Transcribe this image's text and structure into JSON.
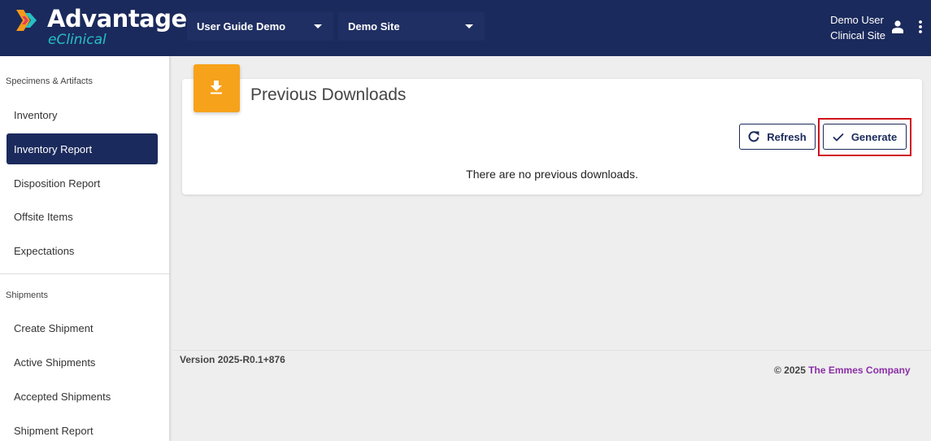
{
  "header": {
    "logo_title": "Advantage",
    "logo_subtitle": "eClinical",
    "study_dropdown": "User Guide Demo",
    "site_dropdown": "Demo Site",
    "user_name": "Demo User",
    "user_role": "Clinical Site",
    "icons": [
      "user-icon",
      "more-vertical-icon",
      "chevron-down-icon"
    ]
  },
  "sidebar": {
    "section1_label": "Specimens & Artifacts",
    "section1_items": [
      {
        "label": "Inventory"
      },
      {
        "label": "Inventory Report",
        "active": true
      },
      {
        "label": "Disposition Report"
      },
      {
        "label": "Offsite Items"
      },
      {
        "label": "Expectations"
      }
    ],
    "section2_label": "Shipments",
    "section2_items": [
      {
        "label": "Create Shipment"
      },
      {
        "label": "Active Shipments"
      },
      {
        "label": "Accepted Shipments"
      },
      {
        "label": "Shipment Report"
      }
    ]
  },
  "main": {
    "title": "Previous Downloads",
    "refresh_label": "Refresh",
    "generate_label": "Generate",
    "empty_message": "There are no previous downloads.",
    "icons": [
      "download-icon",
      "refresh-icon",
      "check-icon"
    ]
  },
  "footer": {
    "version": "Version 2025-R0.1+876",
    "copyright_prefix": "© 2025",
    "company": "The Emmes Company"
  },
  "colors": {
    "header_bg": "#1b2a5c",
    "accent_orange": "#f7a21b",
    "brand_teal": "#26c0c4",
    "company_purple": "#8b2fa6",
    "highlight_red": "#d0121b"
  }
}
